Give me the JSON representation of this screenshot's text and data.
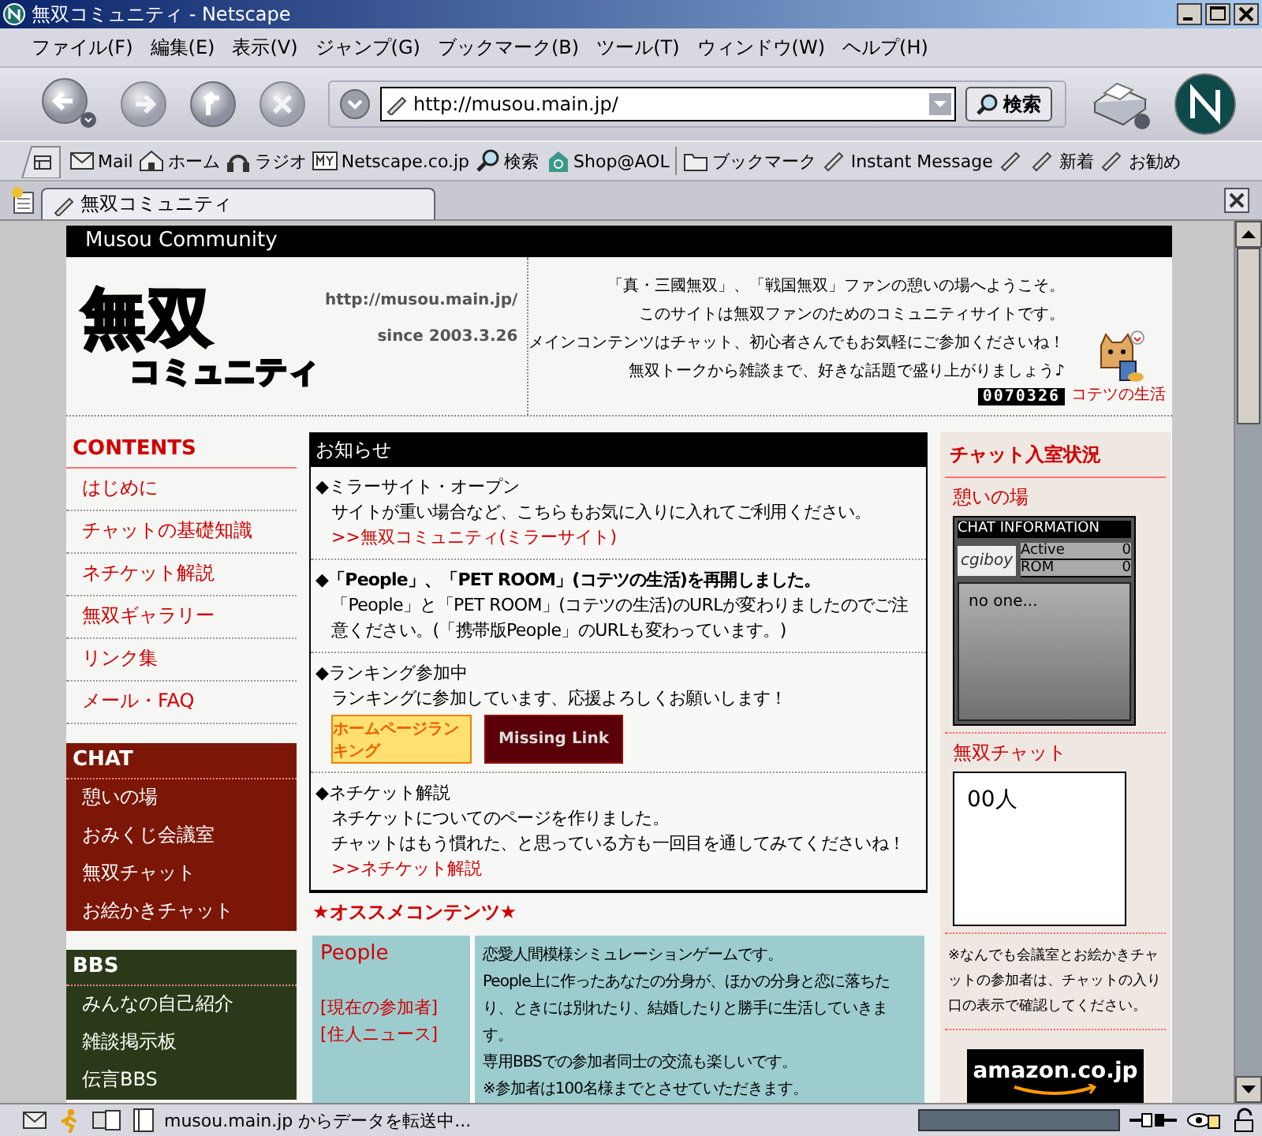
{
  "window": {
    "title": "無双コミュニティ - Netscape"
  },
  "menu": [
    "ファイル(F)",
    "編集(E)",
    "表示(V)",
    "ジャンプ(G)",
    "ブックマーク(B)",
    "ツール(T)",
    "ウィンドウ(W)",
    "ヘルプ(H)"
  ],
  "nav_toolbar": {
    "url": "http://musou.main.jp/",
    "search_button": "検索"
  },
  "personal_toolbar": [
    {
      "kind": "mail",
      "label": "Mail"
    },
    {
      "kind": "home",
      "label": "ホーム"
    },
    {
      "kind": "radio",
      "label": "ラジオ"
    },
    {
      "kind": "my",
      "label": "Netscape.co.jp"
    },
    {
      "kind": "search",
      "label": "検索"
    },
    {
      "kind": "shop",
      "label": "Shop@AOL"
    },
    {
      "kind": "folder",
      "label": "ブックマーク"
    },
    {
      "kind": "bookmark",
      "label": "Instant Message"
    },
    {
      "kind": "bookmark"
    },
    {
      "kind": "bookmark",
      "label": "新着"
    },
    {
      "kind": "bookmark",
      "label": "お勧め"
    }
  ],
  "tabs": [
    {
      "label": "無双コミュニティ",
      "selected": true
    }
  ],
  "page": {
    "site_title": "Musou Community",
    "banner": {
      "logo_top": "無双",
      "logo_bottom": "コミュニティ",
      "url": "http://musou.main.jp/",
      "since": "since 2003.3.26",
      "welcome": [
        "「真・三國無双」、「戦国無双」ファンの憩いの場へようこそ。",
        "このサイトは無双ファンのためのコミュニティサイトです。",
        "メインコンテンツはチャット、初心者さんでもお気軽にご参加くださいね！",
        "無双トークから雑談まで、好きな話題で盛り上がりましょう♪"
      ],
      "counter": "0070326",
      "pet_link": "コテツの生活"
    },
    "nav_sections": [
      {
        "kind": "contents",
        "title": "CONTENTS",
        "items": [
          "はじめに",
          "チャットの基礎知識",
          "ネチケット解説",
          "無双ギャラリー",
          "リンク集",
          "メール・FAQ"
        ]
      },
      {
        "kind": "chat",
        "title": "CHAT",
        "items": [
          "憩いの場",
          "おみくじ会議室",
          "無双チャット",
          "お絵かきチャット"
        ]
      },
      {
        "kind": "bbs",
        "title": "BBS",
        "items": [
          "みんなの自己紹介",
          "雑談掲示板",
          "伝言BBS"
        ]
      }
    ],
    "news": {
      "header": "お知らせ",
      "items": [
        {
          "title": "◆ミラーサイト・オープン",
          "bold": false,
          "text": "サイトが重い場合など、こちらもお気に入りに入れてご利用ください。",
          "link": ">>無双コミュニティ(ミラーサイト)"
        },
        {
          "title": "◆「People」、「PET ROOM」(コテツの生活)を再開しました。",
          "bold": true,
          "text": "「People」と「PET ROOM」(コテツの生活)のURLが変わりましたのでご注意ください。(「携帯版People」のURLも変わっています。)"
        },
        {
          "title": "◆ランキング参加中",
          "bold": false,
          "text": "ランキングに参加しています、応援よろしくお願いします！",
          "banners": [
            "ホームページランキング",
            "Missing Link"
          ]
        },
        {
          "title": "◆ネチケット解説",
          "bold": false,
          "text": "ネチケットについてのページを作りました。",
          "text_2": "チャットはもう慣れた、と思っている方も一回目を通してみてくださいね！",
          "link": ">>ネチケット解説"
        }
      ]
    },
    "recommend": {
      "title": "★オススメコンテンツ★",
      "rows": [
        {
          "name": "People",
          "links": [
            "[現在の参加者]",
            "[住人ニュース]"
          ],
          "description": [
            "恋愛人間模様シミュレーションゲームです。",
            "People上に作ったあなたの分身が、ほかの分身と恋に落ちたり、ときには別れたり、結婚したりと勝手に生活していきます。",
            "専用BBSでの参加者同士の交流も楽しいです。",
            "※参加者は100名様までとさせていただきます。"
          ]
        }
      ]
    },
    "chat_status": {
      "title": "チャット入室状況",
      "rooms": [
        {
          "kind": "widget",
          "name": "憩いの場",
          "header": "CHAT INFORMATION",
          "logo": "cgiboy",
          "active_label": "Active",
          "active": "0",
          "rom_label": "ROM",
          "rom": "0",
          "members": "no one..."
        },
        {
          "kind": "count",
          "name": "無双チャット",
          "count": "00人"
        }
      ],
      "note": "※なんでも会議室とお絵かきチャットの参加者は、チャットの入り口の表示で確認してください。",
      "amazon": "amazon.co.jp"
    }
  },
  "status_bar": {
    "text": "musou.main.jp からデータを転送中...",
    "level": 1
  }
}
